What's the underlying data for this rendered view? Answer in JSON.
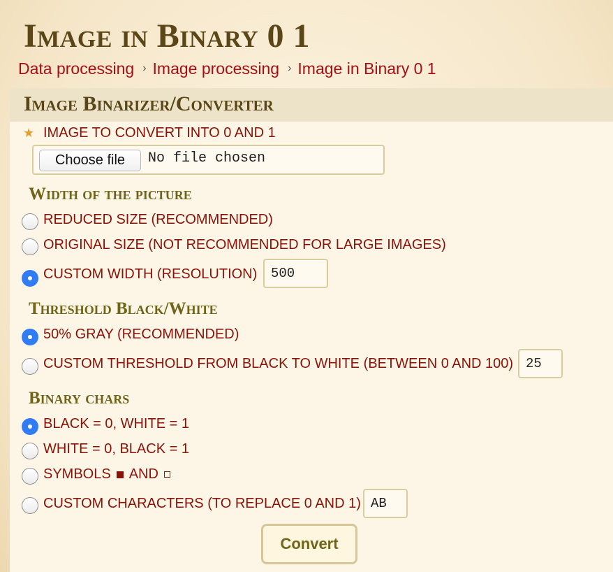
{
  "page": {
    "title": "Image in Binary 0 1"
  },
  "breadcrumb": [
    {
      "label": "Data processing"
    },
    {
      "label": "Image processing"
    },
    {
      "label": "Image in Binary 0 1"
    }
  ],
  "breadcrumb_separator": "›",
  "panel": {
    "title": "Image Binarizer/Converter"
  },
  "file": {
    "label": "Image to convert into 0 and 1",
    "button_label": "Choose file",
    "status": "No file chosen",
    "required_icon": "star-icon"
  },
  "width_section": {
    "title": "Width of the picture",
    "options": [
      {
        "label": "Reduced size (recommended)",
        "checked": false
      },
      {
        "label": "Original size (not recommended for large images)",
        "checked": false
      },
      {
        "label": "Custom width (resolution)",
        "checked": true
      }
    ],
    "custom_value": "500"
  },
  "threshold_section": {
    "title": "Threshold Black/White",
    "options": [
      {
        "label": "50% gray (recommended)",
        "checked": true
      },
      {
        "label": "Custom threshold from black to white (between 0 and 100)",
        "checked": false
      }
    ],
    "custom_value": "25"
  },
  "chars_section": {
    "title": "Binary chars",
    "options": [
      {
        "label": "Black = 0, White = 1",
        "checked": true
      },
      {
        "label": "White = 0, Black = 1",
        "checked": false
      },
      {
        "label_pre": "Symbols",
        "label_mid": "and",
        "checked": false
      },
      {
        "label": "Custom characters (to replace 0 and 1)",
        "checked": false
      }
    ],
    "custom_value": "AB"
  },
  "convert_button": "Convert",
  "colors": {
    "accent_text": "#8a1208",
    "breadcrumb_link": "#a50f16",
    "section_title": "#6f6418",
    "page_title": "#5b4617",
    "radio_selected": "#2f7cf6"
  }
}
